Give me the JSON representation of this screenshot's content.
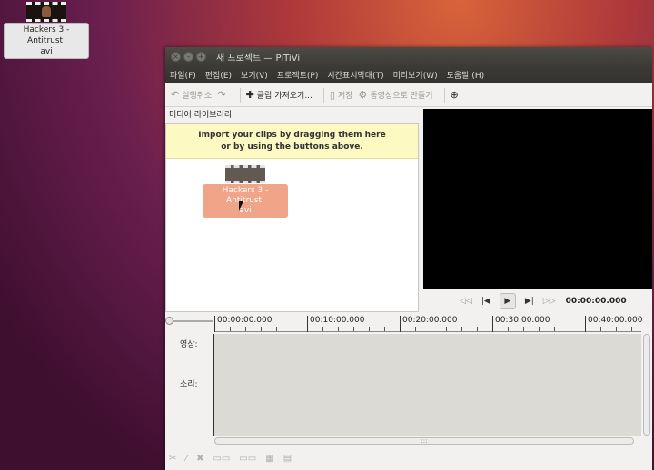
{
  "desktop": {
    "icon_label": "Hackers 3 - Antitrust.\navi"
  },
  "window": {
    "title": "새 프로젝트 — PiTiVi",
    "controls": [
      "×",
      "–",
      "+"
    ]
  },
  "menu": [
    "파일(F)",
    "편집(E)",
    "보기(V)",
    "프로젝트(P)",
    "시간표시막대(T)",
    "미리보기(W)",
    "도움말 (H)"
  ],
  "toolbar": {
    "undo": "실행취소",
    "import": "클립 가져오기...",
    "save": "저장",
    "render": "동영상으로 만들기"
  },
  "library": {
    "title": "미디어 라이브러리",
    "hint_line1": "Import your clips by dragging them here",
    "hint_line2": "or by using the buttons above.",
    "clip_label": "Hackers 3 - Antitrust.\navi"
  },
  "playback": {
    "timecode": "00:00:00.000"
  },
  "ruler": [
    "00:00:00.000",
    "00:10:00.000",
    "00:20:00.000",
    "00:30:00.000",
    "00:40:00.000"
  ],
  "tracks": {
    "video": "영상:",
    "audio": "소리:"
  }
}
